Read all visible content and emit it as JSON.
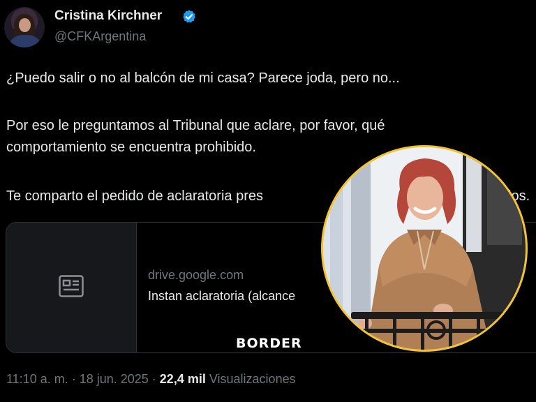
{
  "tweet": {
    "author_name": "Cristina Kirchner",
    "handle": "@CFKArgentina",
    "lines": [
      "¿Puedo salir o no al balcón de mi casa? Parece joda, pero no...",
      "Por eso le preguntamos al Tribunal que aclare, por favor, qué",
      "comportamiento se encuentra prohibido.",
      "Te comparto el pedido de aclaratoria pres",
      "los."
    ],
    "card": {
      "domain": "drive.google.com",
      "title": "Instan aclaratoria (alcance"
    },
    "meta": {
      "datetime": "11:10 a. m. · 18 jun. 2025 · ",
      "views_count": "22,4 mil",
      "views_label": " Visualizaciones"
    }
  },
  "overlay": {
    "watermark": "BORDER"
  },
  "colors": {
    "background": "#000000",
    "text": "#e7e9ea",
    "secondary": "#71767b",
    "verified": "#1d9bf0",
    "photo_ring": "#f2c230"
  },
  "icons": [
    "verified-badge-icon",
    "news-article-icon"
  ]
}
